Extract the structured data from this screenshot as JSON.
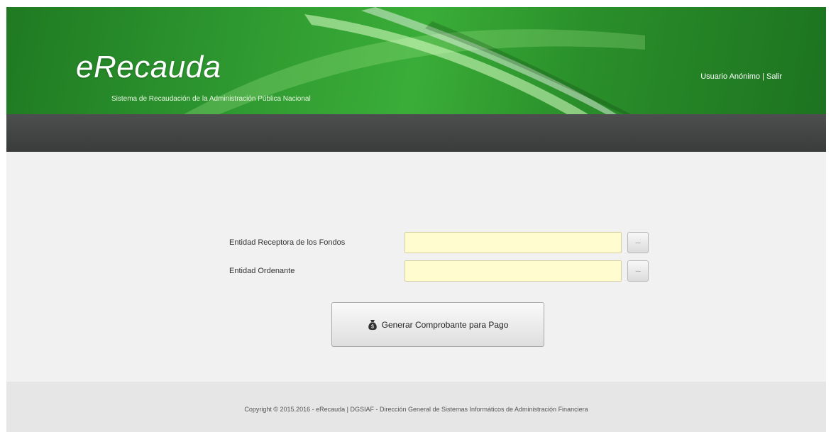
{
  "header": {
    "logo_text": "eRecauda",
    "tagline": "Sistema de Recaudación de la Administración Pública Nacional",
    "user_label": "Usuario Anónimo",
    "separator": "|",
    "logout_label": "Salir"
  },
  "form": {
    "receptor_label": "Entidad Receptora de los Fondos",
    "receptor_value": "",
    "ordenante_label": "Entidad Ordenante",
    "ordenante_value": "",
    "lookup_label": "...",
    "generate_button_label": "Generar Comprobante para Pago",
    "generate_button_icon": "money-bag-icon"
  },
  "footer": {
    "copyright": "Copyright © 2015.2016 - eRecauda | DGSIAF - Dirección General de Sistemas Informáticos de Administración Financiera"
  },
  "colors": {
    "banner_green": "#2f9a31",
    "navbar_dark": "#434544",
    "input_yellow": "#fffccf"
  }
}
